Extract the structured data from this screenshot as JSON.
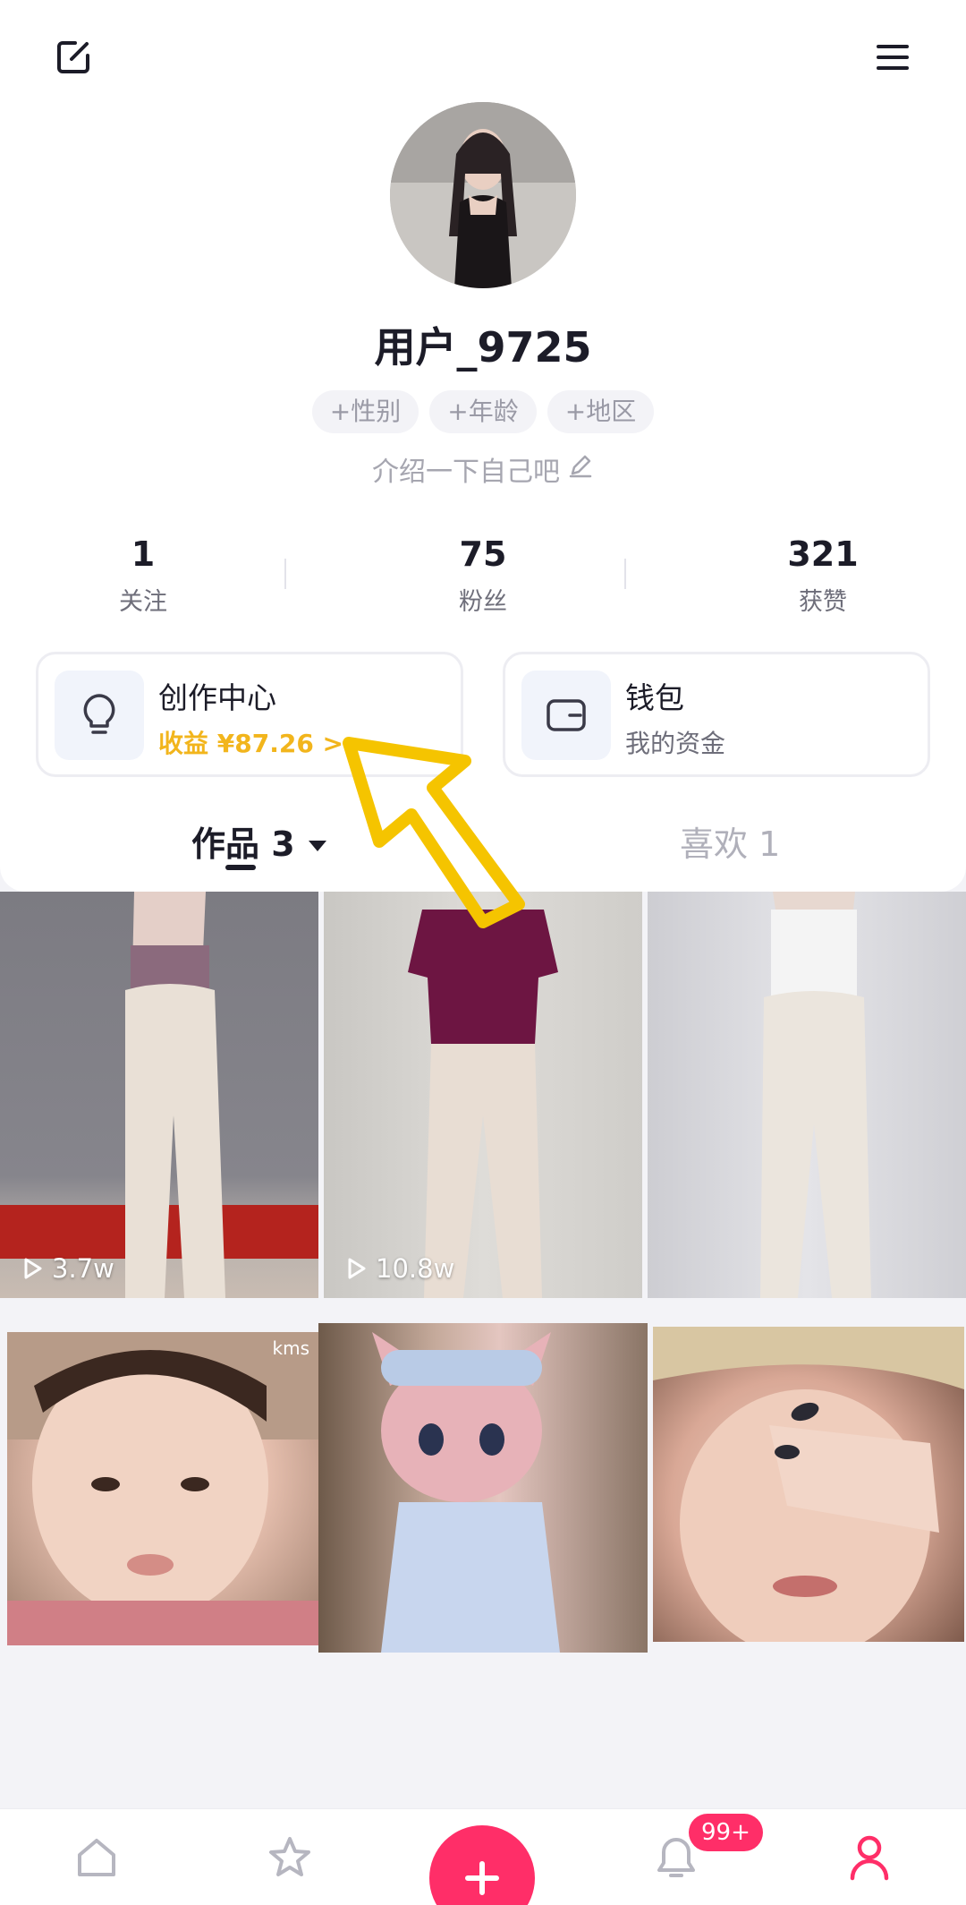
{
  "header": {
    "edit_icon": "edit-square-icon",
    "menu_icon": "hamburger-menu-icon"
  },
  "profile": {
    "username": "用户_9725",
    "tags": [
      "+性别",
      "+年龄",
      "+地区"
    ],
    "bio_placeholder": "介绍一下自己吧"
  },
  "stats": [
    {
      "value": "1",
      "label": "关注"
    },
    {
      "value": "75",
      "label": "粉丝"
    },
    {
      "value": "321",
      "label": "获赞"
    }
  ],
  "features": {
    "creator": {
      "title": "创作中心",
      "subtitle": "收益 ¥87.26 >",
      "icon": "lightbulb-icon"
    },
    "wallet": {
      "title": "钱包",
      "subtitle": "我的资金",
      "icon": "wallet-icon"
    }
  },
  "tabs": {
    "works": "作品 3",
    "likes": "喜欢 1"
  },
  "grid": [
    {
      "views": "3.7w"
    },
    {
      "views": "10.8w"
    },
    {
      "views": ""
    },
    {
      "views": ""
    },
    {
      "views": ""
    },
    {
      "views": ""
    }
  ],
  "thumb_watermark": "kms",
  "nav": {
    "items": [
      "home-icon",
      "star-icon",
      "plus-icon",
      "bell-icon",
      "person-icon"
    ],
    "notify_badge": "99+"
  },
  "colors": {
    "accent": "#ff2e68",
    "earnings": "#f2b51c",
    "arrow": "#f5c400"
  }
}
